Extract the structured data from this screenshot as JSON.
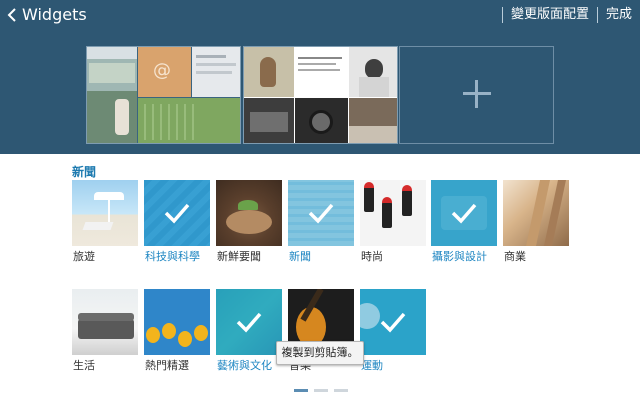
{
  "header": {
    "title": "Widgets",
    "action_change_layout": "變更版面配置",
    "action_done": "完成"
  },
  "section": {
    "title": "新聞"
  },
  "tiles": [
    {
      "label": "旅遊",
      "selected": false
    },
    {
      "label": "科技與科學",
      "selected": true
    },
    {
      "label": "新鮮要聞",
      "selected": false
    },
    {
      "label": "新聞",
      "selected": true
    },
    {
      "label": "時尚",
      "selected": false
    },
    {
      "label": "攝影與設計",
      "selected": true
    },
    {
      "label": "商業",
      "selected": false
    },
    {
      "label": "生活",
      "selected": false
    },
    {
      "label": "熱門精選",
      "selected": false
    },
    {
      "label": "藝術與文化",
      "selected": true
    },
    {
      "label": "音樂",
      "selected": false
    },
    {
      "label": "運動",
      "selected": true
    }
  ],
  "toast": "複製到剪貼簿。",
  "pager": {
    "count": 3,
    "active": 1
  },
  "icons": {
    "back": "chevron-left-icon",
    "plus": "plus-icon",
    "check": "check-icon",
    "page_up": "home-up-icon"
  },
  "colors": {
    "header_bg": "#2e5773",
    "accent": "#1e86c2",
    "section_title": "#1e7bb0"
  }
}
